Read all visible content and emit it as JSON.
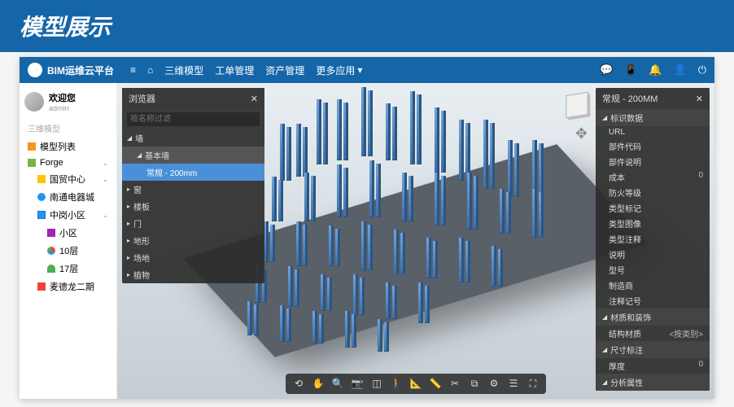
{
  "banner": "模型展示",
  "topbar": {
    "app_name": "BIM运维云平台",
    "menu": [
      "首页",
      "三维模型",
      "工单管理",
      "资产管理",
      "更多应用"
    ],
    "menu_caret": "▾"
  },
  "user": {
    "welcome": "欢迎您",
    "role": "admin"
  },
  "sidebar": {
    "section": "三维模型",
    "items": {
      "model_list": "模型列表",
      "forge": "Forge",
      "guomao": "国贸中心",
      "nantong": "南通电器城",
      "zhonggang": "中岗小区",
      "xiaoqu": "小区",
      "floor10": "10层",
      "floor17": "17层",
      "meidelong": "麦德龙二期"
    }
  },
  "browser": {
    "title": "浏览器",
    "search_placeholder": "按名称过滤",
    "tree": {
      "wall": "墙",
      "basic_wall": "基本墙",
      "selected": "常规 - 200mm",
      "window": "窗",
      "floor": "楼板",
      "door": "门",
      "terrain": "地形",
      "ground": "场地",
      "plant": "植物"
    }
  },
  "properties": {
    "title": "常规 - 200MM",
    "sections": {
      "id_data": "标识数据",
      "material": "材质和装饰",
      "dimension": "尺寸标注",
      "analysis": "分析属性"
    },
    "rows": {
      "url": "URL",
      "part_code": "部件代码",
      "part_desc": "部件说明",
      "cost": "成本",
      "cost_val": "0",
      "fire": "防火等级",
      "type_mark": "类型标记",
      "type_image": "类型图像",
      "type_note": "类型注释",
      "desc": "说明",
      "model_no": "型号",
      "mfr": "制造商",
      "note_mark": "注释记号",
      "struct_mat": "结构材质",
      "struct_mat_val": "<按类别>",
      "thickness": "厚度",
      "thickness_val": "0"
    }
  },
  "toolbar_icons": [
    "orbit",
    "pan",
    "zoom",
    "camera",
    "section",
    "firstperson",
    "measure",
    "ruler",
    "explode",
    "model",
    "settings",
    "props",
    "fullscreen"
  ]
}
